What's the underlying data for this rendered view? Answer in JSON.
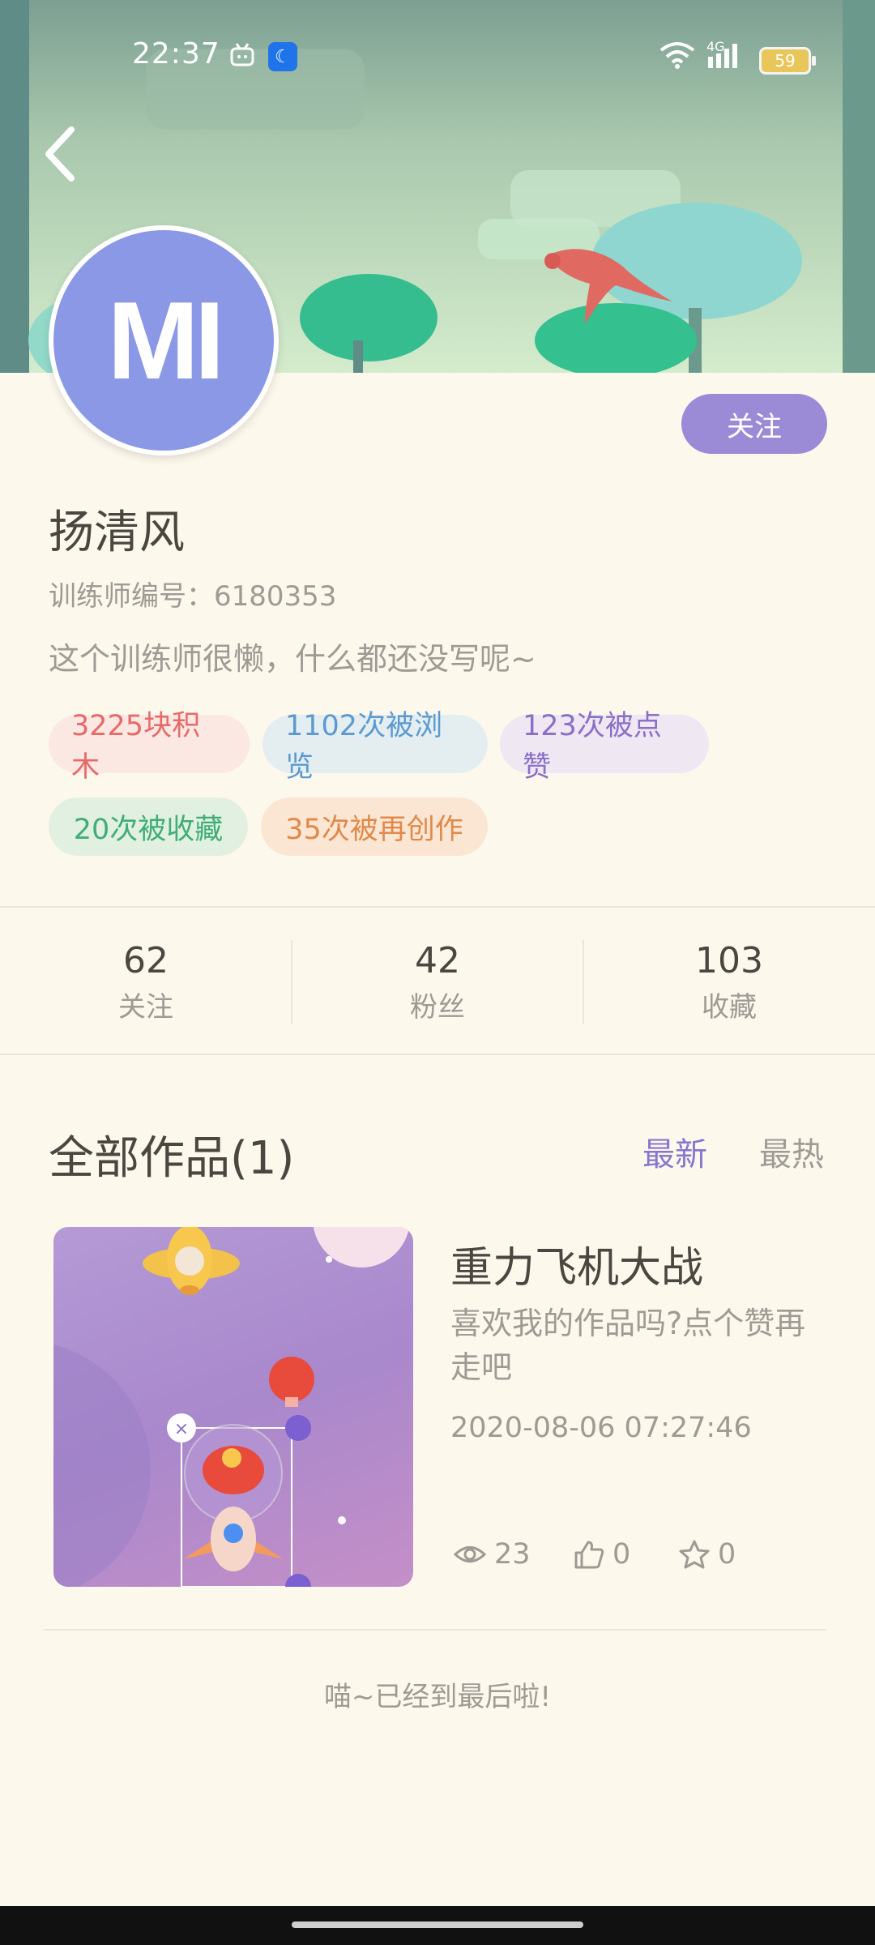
{
  "status_bar": {
    "time": "22:37",
    "network": "4G",
    "battery": "59",
    "icons": [
      "android-icon",
      "moon-icon",
      "wifi-icon",
      "signal-icon",
      "battery-icon"
    ]
  },
  "profile": {
    "avatar_text": "MI",
    "follow_label": "关注",
    "name": "扬清风",
    "trainer_id": "训练师编号：6180353",
    "bio": "这个训练师很懒，什么都还没写呢~",
    "tags": [
      {
        "text": "3225块积木",
        "color": "#e66a6a",
        "bg": "#fbe8e2"
      },
      {
        "text": "1102次被浏览",
        "color": "#5b9ad0",
        "bg": "#e4eef0"
      },
      {
        "text": "123次被点赞",
        "color": "#8a6fc8",
        "bg": "#efe8f2"
      },
      {
        "text": "20次被收藏",
        "color": "#3fae77",
        "bg": "#e2f0e2"
      },
      {
        "text": "35次被再创作",
        "color": "#e08a4a",
        "bg": "#fbe6d3"
      }
    ]
  },
  "stats": [
    {
      "value": "62",
      "label": "关注"
    },
    {
      "value": "42",
      "label": "粉丝"
    },
    {
      "value": "103",
      "label": "收藏"
    }
  ],
  "works": {
    "title": "全部作品(1)",
    "sort_new": "最新",
    "sort_hot": "最热",
    "items": [
      {
        "title": "重力飞机大战",
        "description": "喜欢我的作品吗?点个赞再走吧",
        "date": "2020-08-06 07:27:46",
        "views": "23",
        "likes": "0",
        "favorites": "0"
      }
    ]
  },
  "footer": {
    "end_text": "喵~已经到最后啦!"
  },
  "colors": {
    "accent": "#8676cf",
    "follow_button": "#9b8bd6",
    "background": "#fdf8ec",
    "avatar": "#8b98e6"
  }
}
